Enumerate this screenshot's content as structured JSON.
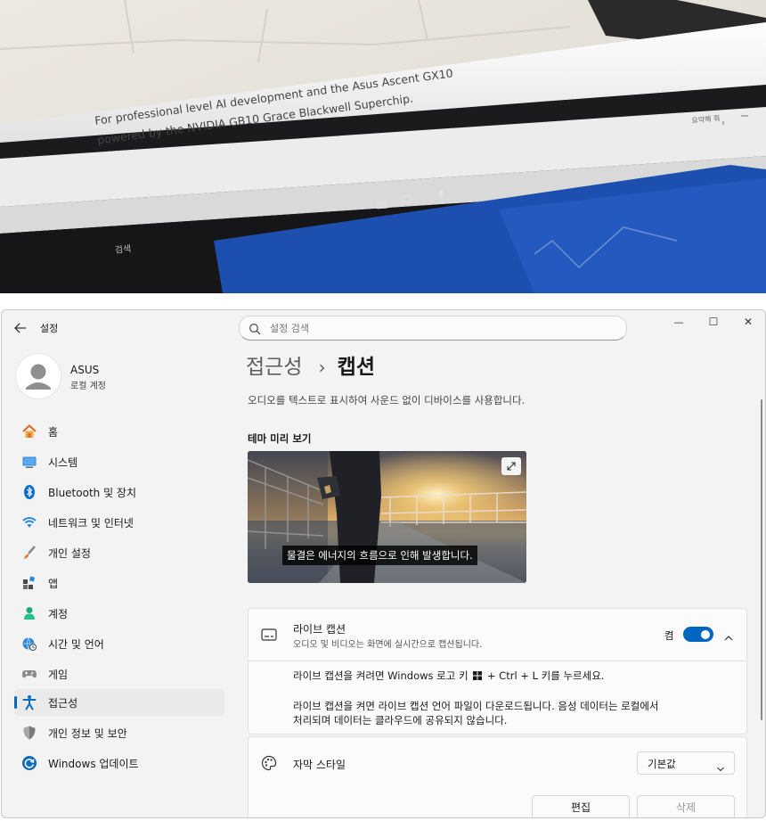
{
  "photo": {
    "headline_line1": "For professional level AI development and the Asus Ascent GX10",
    "headline_line2": "powered by the NVIDIA GB10 Grace Blackwell Superchip.",
    "search_label": "검색",
    "corner_text": "요약해 줘"
  },
  "window": {
    "title": "설정",
    "search_placeholder": "설정 검색",
    "controls": {
      "minimize": "—",
      "maximize": "☐",
      "close": "✕"
    }
  },
  "user": {
    "name": "ASUS",
    "account_type": "로컬 계정"
  },
  "nav": [
    {
      "label": "홈",
      "icon": "home-icon"
    },
    {
      "label": "시스템",
      "icon": "monitor-icon"
    },
    {
      "label": "Bluetooth 및 장치",
      "icon": "bluetooth-icon"
    },
    {
      "label": "네트워크 및 인터넷",
      "icon": "wifi-icon"
    },
    {
      "label": "개인 설정",
      "icon": "brush-icon"
    },
    {
      "label": "앱",
      "icon": "apps-icon"
    },
    {
      "label": "계정",
      "icon": "person-icon"
    },
    {
      "label": "시간 및 언어",
      "icon": "globe-clock-icon"
    },
    {
      "label": "게임",
      "icon": "gamepad-icon"
    },
    {
      "label": "접근성",
      "icon": "accessibility-icon",
      "active": true
    },
    {
      "label": "개인 정보 및 보안",
      "icon": "shield-icon"
    },
    {
      "label": "Windows 업데이트",
      "icon": "update-icon"
    }
  ],
  "main": {
    "breadcrumb_parent": "접근성",
    "breadcrumb_sep": "›",
    "breadcrumb_current": "캡션",
    "description": "오디오를 텍스트로 표시하여 사운드 없이 디바이스를 사용합니다.",
    "preview_label": "테마 미리 보기",
    "preview_caption": "물결은 에너지의 흐름으로 인해 발생합니다."
  },
  "live_caption": {
    "title": "라이브 캡션",
    "subtitle": "오디오 및 비디오는 화면에 실시간으로 캡션됩니다.",
    "toggle_label": "켬",
    "toggle_on": true,
    "info_prefix": "라이브 캡션을 켜려면 Windows 로고 키",
    "info_suffix": "+ Ctrl + L 키를 누르세요.",
    "info2_line1": "라이브 캡션을 켜면 라이브 캡션 언어 파일이 다운로드됩니다. 음성 데이터는 로컬에서",
    "info2_line2": "처리되며 데이터는 클라우드에 공유되지 않습니다."
  },
  "caption_style": {
    "title": "자막 스타일",
    "selected": "기본값",
    "edit_label": "편집",
    "delete_label": "삭제"
  },
  "colors": {
    "accent": "#0067c0",
    "window_bg": "#f3f3f3",
    "card_bg": "#fbfbfb"
  }
}
